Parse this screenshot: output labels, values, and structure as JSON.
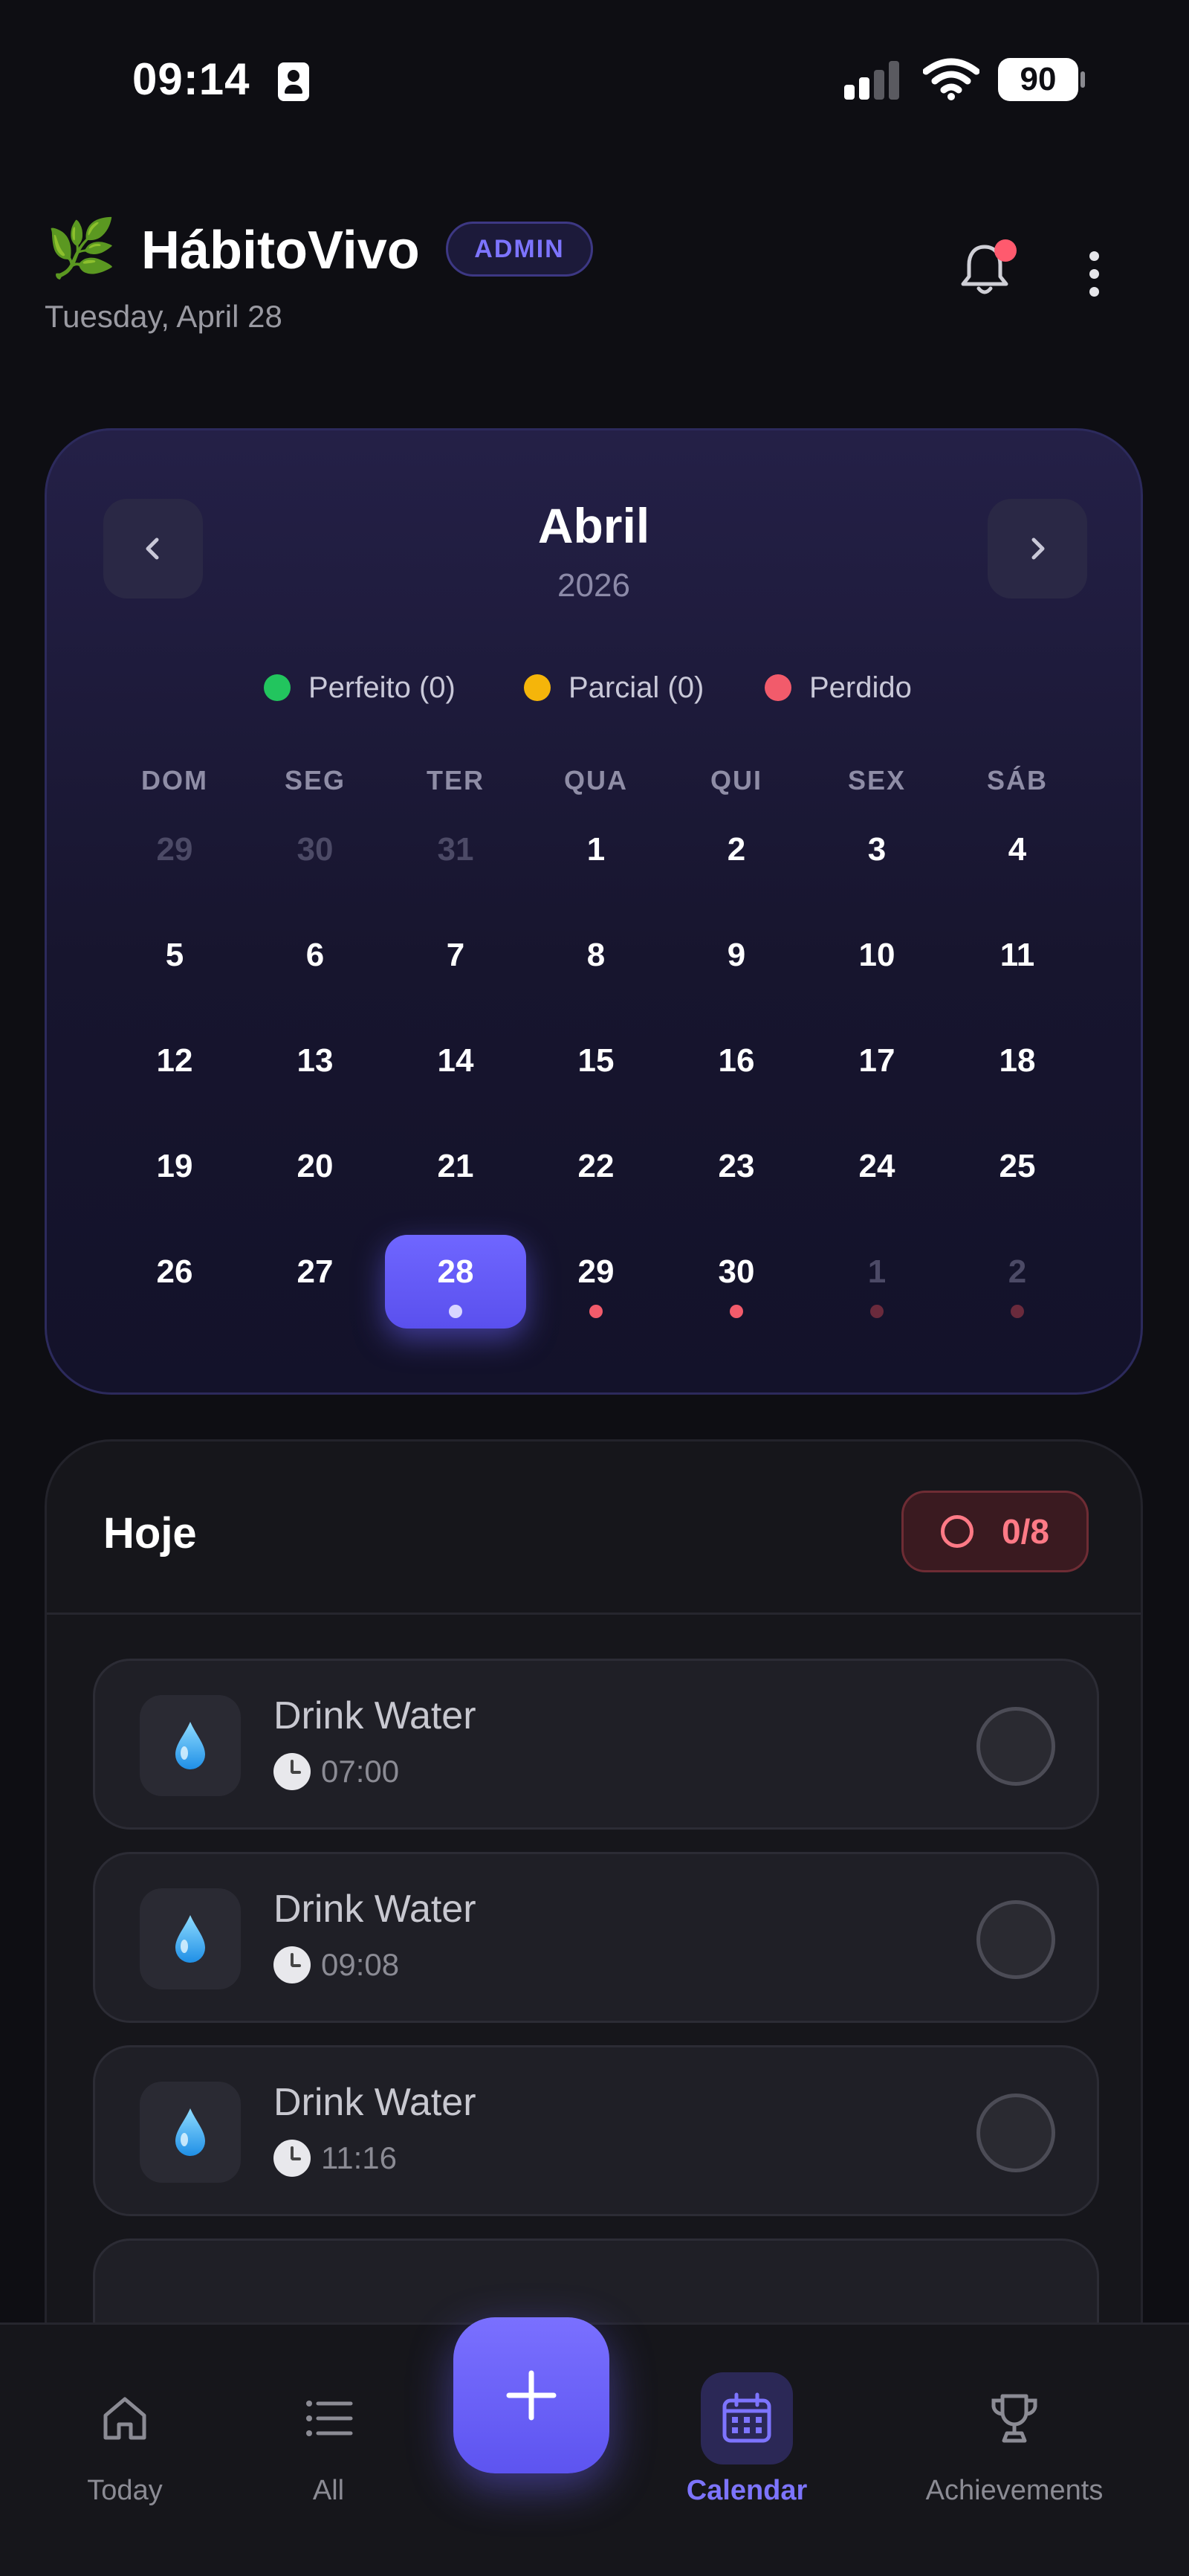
{
  "status_bar": {
    "time": "09:14",
    "battery": "90"
  },
  "header": {
    "brand_icon": "🌿",
    "title": "HábitoVivo",
    "badge": "ADMIN",
    "date": "Tuesday, April 28"
  },
  "calendar": {
    "month": "Abril",
    "year": "2026",
    "legend": [
      {
        "label": "Perfeito (0)",
        "color": "#22c55e"
      },
      {
        "label": "Parcial (0)",
        "color": "#f5b50a"
      },
      {
        "label": "Perdido",
        "color": "#f25b6b"
      }
    ],
    "weekdays": [
      "DOM",
      "SEG",
      "TER",
      "QUA",
      "QUI",
      "SEX",
      "SÁB"
    ],
    "weeks": [
      [
        "29",
        "30",
        "31",
        "1",
        "2",
        "3",
        "4"
      ],
      [
        "5",
        "6",
        "7",
        "8",
        "9",
        "10",
        "11"
      ],
      [
        "12",
        "13",
        "14",
        "15",
        "16",
        "17",
        "18"
      ],
      [
        "19",
        "20",
        "21",
        "22",
        "23",
        "24",
        "25"
      ],
      [
        "26",
        "27",
        "28",
        "29",
        "30",
        "1",
        "2"
      ]
    ],
    "selected_day": "28"
  },
  "today": {
    "title": "Hoje",
    "progress": "0/8",
    "habits": [
      {
        "icon": "💧",
        "name": "Drink Water",
        "time": "07:00"
      },
      {
        "icon": "💧",
        "name": "Drink Water",
        "time": "09:08"
      },
      {
        "icon": "💧",
        "name": "Drink Water",
        "time": "11:16"
      }
    ]
  },
  "bottom_nav": {
    "items": [
      {
        "label": "Today",
        "icon": "home-icon"
      },
      {
        "label": "All",
        "icon": "list-icon"
      },
      {
        "label": "Calendar",
        "icon": "calendar-icon",
        "active": true
      },
      {
        "label": "Achievements",
        "icon": "trophy-icon"
      }
    ],
    "fab_icon": "plus-icon"
  },
  "colors": {
    "accent": "#6f66ff",
    "missed": "#f25b6b",
    "background": "#0e0e13"
  }
}
